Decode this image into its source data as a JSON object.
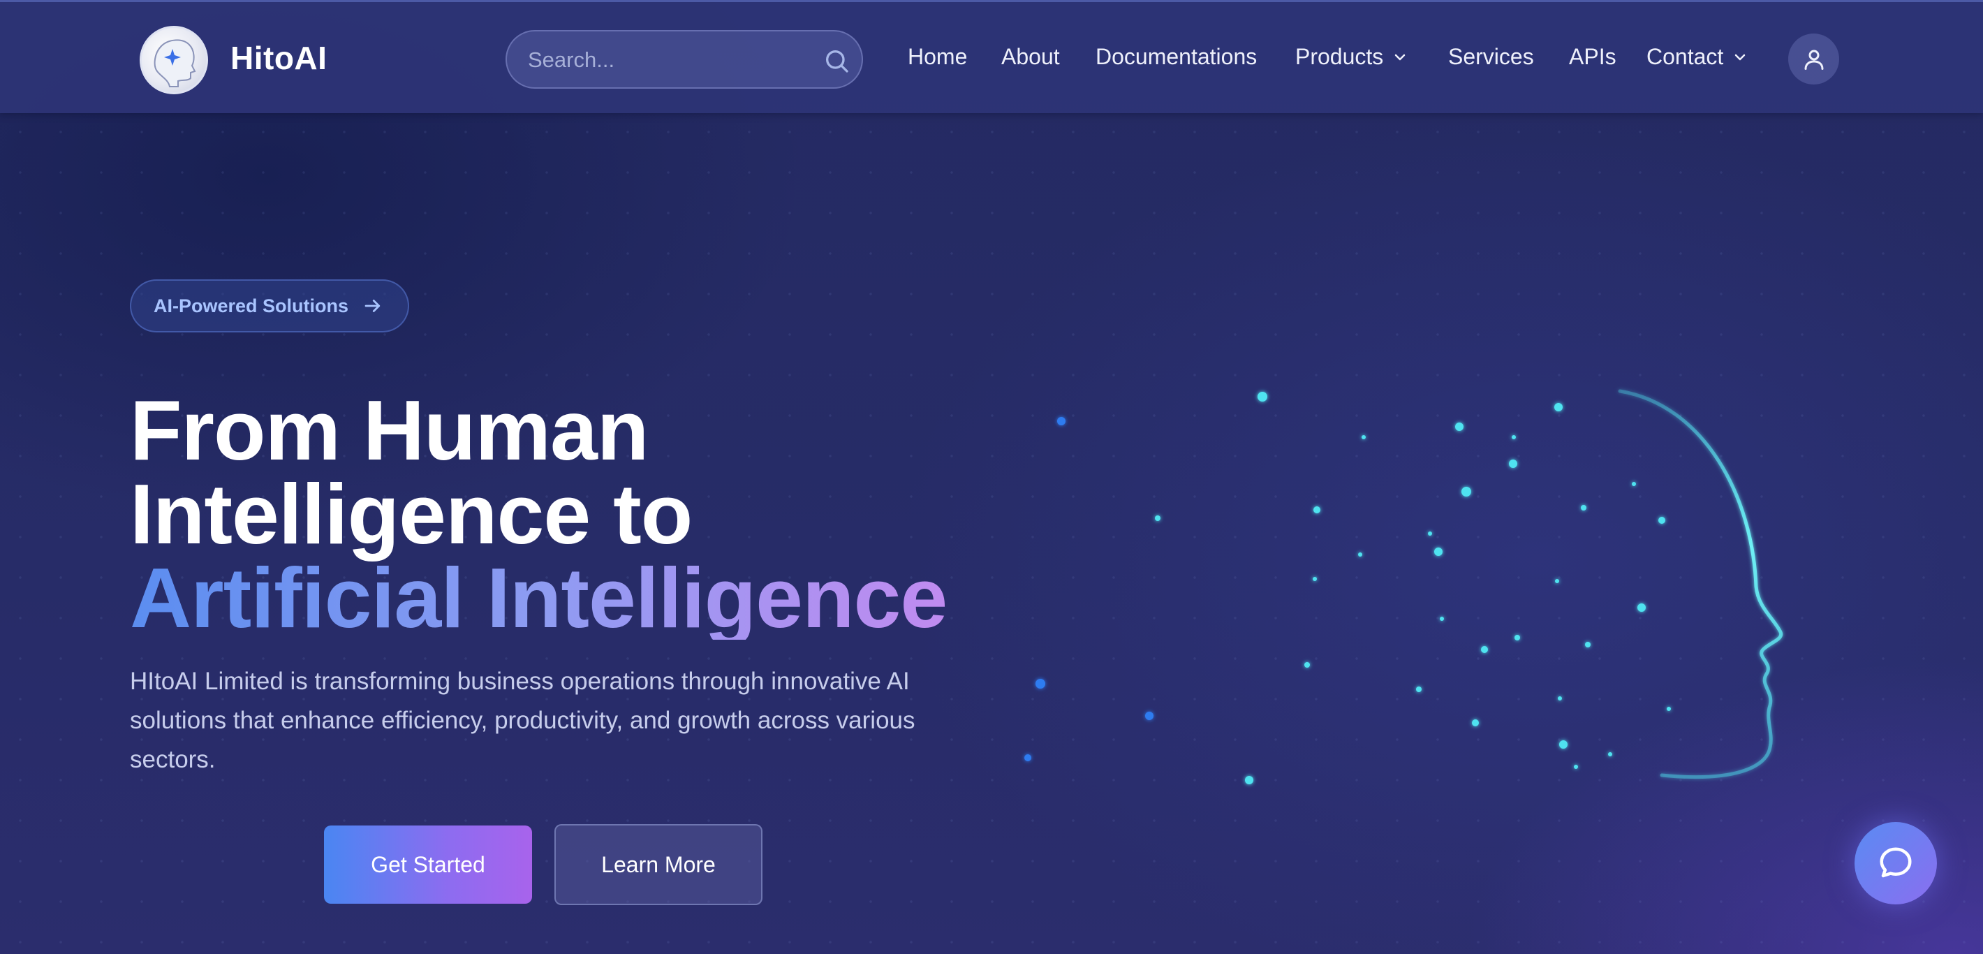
{
  "header": {
    "brand": "HitoAI",
    "search_placeholder": "Search...",
    "nav": {
      "home": "Home",
      "about": "About",
      "docs": "Documentations",
      "products": "Products",
      "services": "Services",
      "apis": "APIs",
      "contact": "Contact"
    }
  },
  "hero": {
    "badge": "AI-Powered Solutions",
    "title_line1": "From Human",
    "title_line2": "Intelligence to",
    "title_line3": "Artificial Intelligence",
    "description": "HItoAI Limited is transforming business operations through innovative AI solutions that enhance efficiency, productivity, and growth across various sectors.",
    "primary_button": "Get Started",
    "secondary_button": "Learn More"
  },
  "icons": {
    "search": "search-icon",
    "products_dropdown": "chevron-down-icon",
    "contact_dropdown": "chevron-down-icon",
    "user": "user-icon",
    "badge_arrow": "arrow-right-icon",
    "chat": "chat-bubble-icon"
  },
  "colors": {
    "background": "#252a63",
    "accent_blue": "#4a86f2",
    "accent_purple": "#a863ec",
    "cyan": "#4fe3f0"
  }
}
